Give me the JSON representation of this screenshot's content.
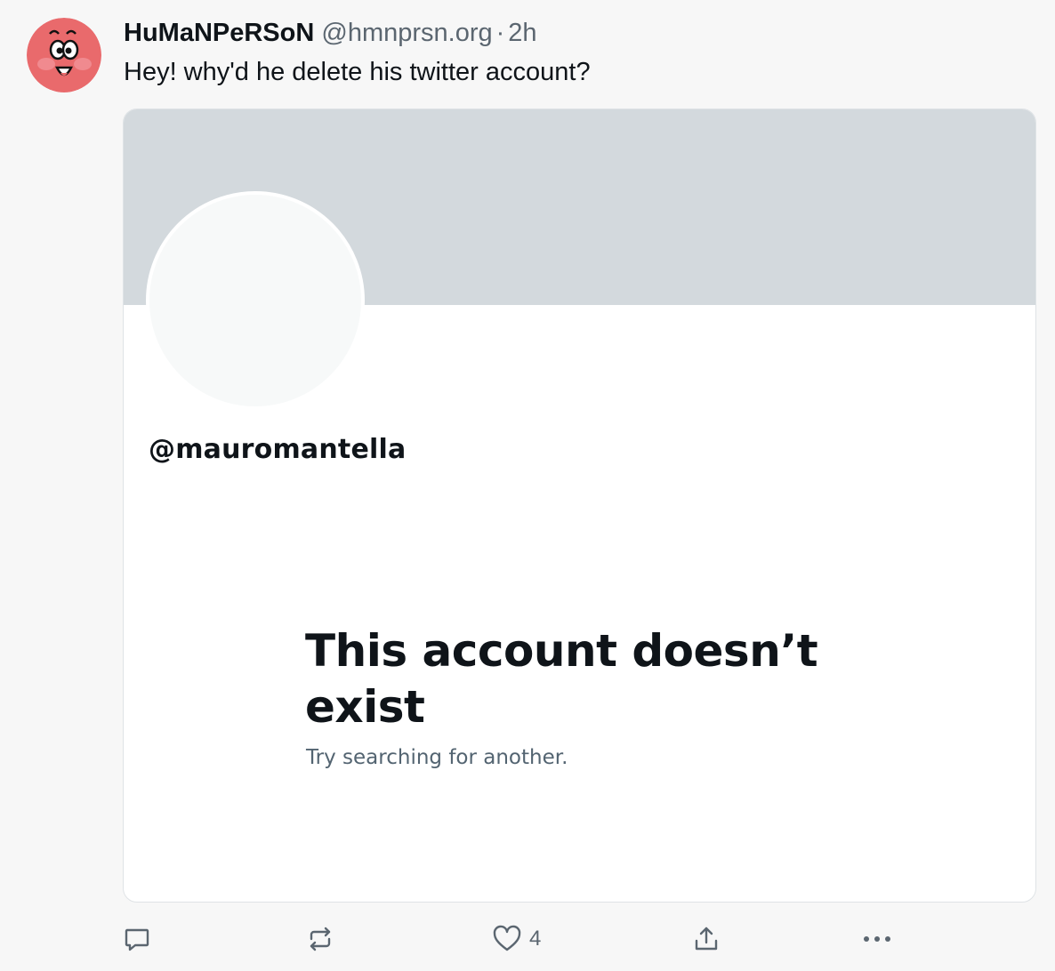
{
  "post": {
    "author": {
      "display_name": "HuMaNPeRSoN",
      "handle": "@hmnprsn.org",
      "separator": "·",
      "time": "2h"
    },
    "text": "Hey! why'd he delete his twitter account?",
    "embed": {
      "profile_handle": "@mauromantella",
      "title": "This account doesn’t exist",
      "subtitle": "Try searching for another."
    },
    "actions": {
      "like_count": "4"
    }
  },
  "icons": [
    "reply-icon",
    "repost-icon",
    "heart-icon",
    "share-icon",
    "more-icon"
  ]
}
